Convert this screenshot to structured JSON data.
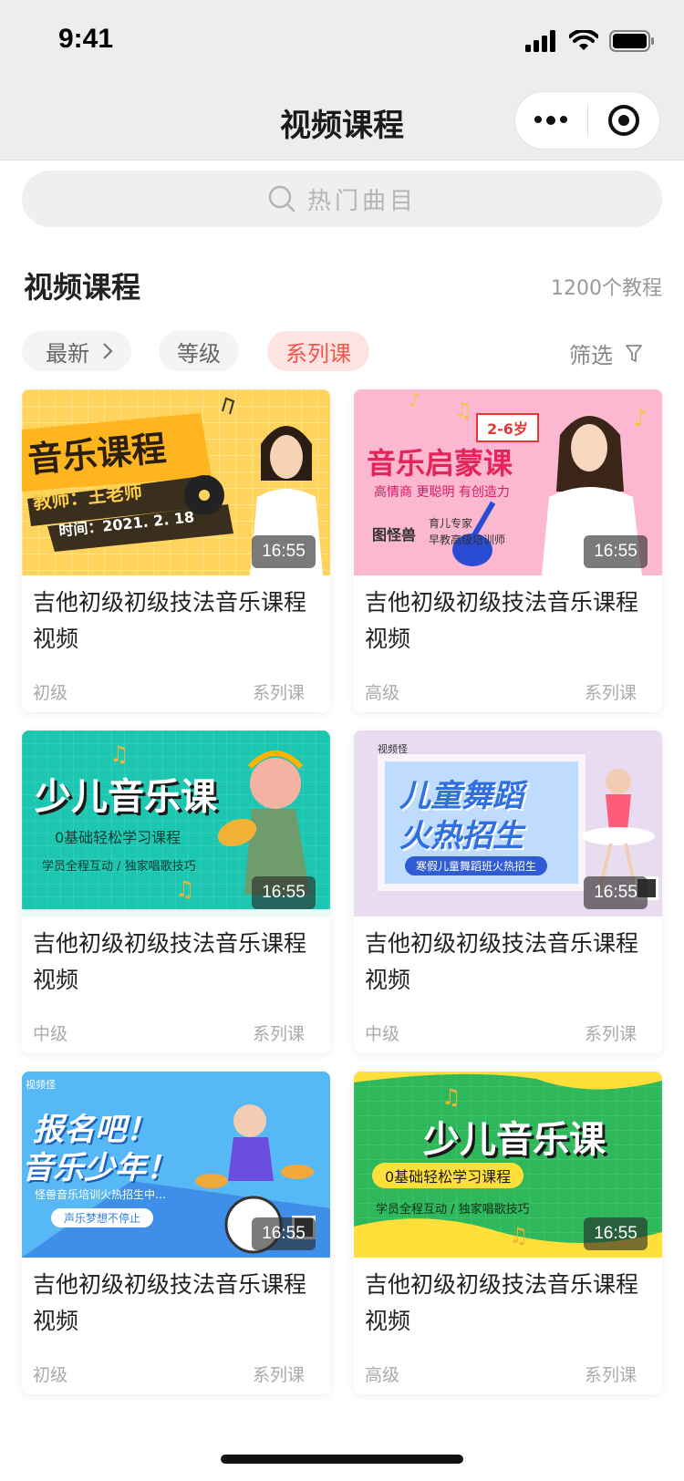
{
  "status_bar": {
    "time": "9:41"
  },
  "nav": {
    "title": "视频课程"
  },
  "search": {
    "placeholder": "热门曲目"
  },
  "section": {
    "title": "视频课程",
    "count": "1200个教程"
  },
  "filters": {
    "latest": "最新",
    "level": "等级",
    "series": "系列课",
    "filter": "筛选"
  },
  "courses": [
    {
      "title": "吉他初级初级技法音乐课程视频",
      "level": "初级",
      "type": "系列课",
      "duration": "16:55",
      "thumb": {
        "headline": "音乐课程",
        "teacher": "教师：王老师",
        "date": "时间：2021. 2. 18"
      }
    },
    {
      "title": "吉他初级初级技法音乐课程视频",
      "level": "高级",
      "type": "系列课",
      "duration": "16:55",
      "thumb": {
        "age": "2-6岁",
        "headline": "音乐启蒙课",
        "slogan": "高情商 更聪明 有创造力",
        "brand": "图怪兽",
        "expert": "育儿专家",
        "trainer": "早教高级培训师"
      }
    },
    {
      "title": "吉他初级初级技法音乐课程视频",
      "level": "中级",
      "type": "系列课",
      "duration": "16:55",
      "thumb": {
        "headline": "少儿音乐课",
        "sub": "0基础轻松学习课程",
        "tags": "学员全程互动 / 独家唱歌技巧"
      }
    },
    {
      "title": "吉他初级初级技法音乐课程视频",
      "level": "中级",
      "type": "系列课",
      "duration": "16:55",
      "thumb": {
        "logo": "视频怪",
        "line1": "儿童舞蹈",
        "line2": "火热招生",
        "banner": "寒假儿童舞蹈班火热招生"
      }
    },
    {
      "title": "吉他初级初级技法音乐课程视频",
      "level": "初级",
      "type": "系列课",
      "duration": "16:55",
      "thumb": {
        "logo": "视频怪",
        "line1": "报名吧！",
        "line2": "音乐少年！",
        "sub": "怪兽音乐培训火热招生中…",
        "button": "声乐梦想不停止"
      }
    },
    {
      "title": "吉他初级初级技法音乐课程视频",
      "level": "高级",
      "type": "系列课",
      "duration": "16:55",
      "thumb": {
        "headline": "少儿音乐课",
        "sub": "0基础轻松学习课程",
        "tags": "学员全程互动 / 独家唱歌技巧"
      }
    }
  ]
}
